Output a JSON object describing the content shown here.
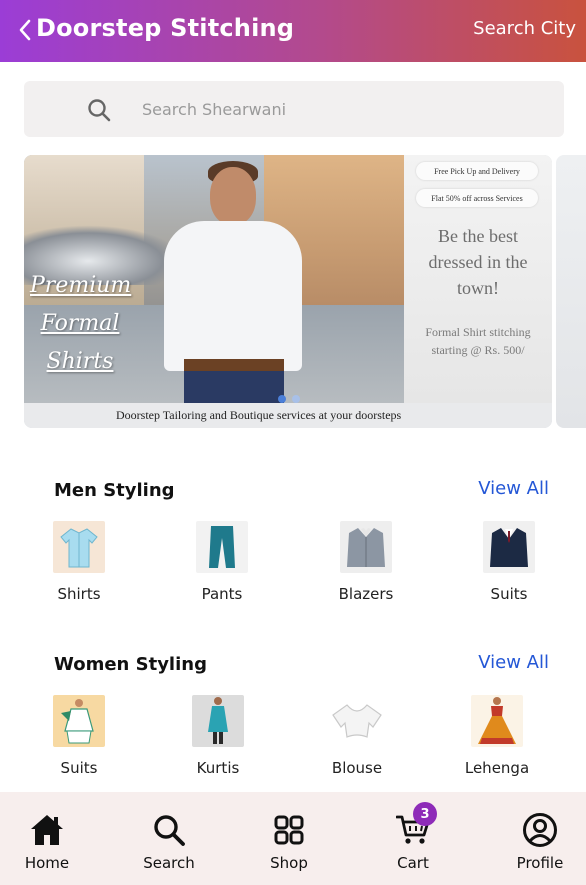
{
  "header": {
    "title": "Doorstep Stitching",
    "city_link": "Search City",
    "back_icon": "chevron-left-icon"
  },
  "search": {
    "placeholder": "Search Shearwani",
    "icon": "search-icon"
  },
  "banner": {
    "premium_lines": [
      "Premium",
      "Formal",
      "Shirts"
    ],
    "pill_1": "Free Pick Up and Delivery",
    "pill_2": "Flat 50% off across Services",
    "tagline": "Be the best dressed in the town!",
    "offer": "Formal Shirt stitching starting @ Rs. 500/",
    "caption": "Doorstep Tailoring and Boutique services at your doorsteps",
    "active_slide": 1,
    "slide_count": 2
  },
  "men": {
    "title": "Men Styling",
    "view_all": "View All",
    "items": [
      {
        "label": "Shirts",
        "icon": "shirt-icon",
        "color": "#a8dcef"
      },
      {
        "label": "Pants",
        "icon": "pants-icon",
        "color": "#1f7a8c"
      },
      {
        "label": "Blazers",
        "icon": "blazer-icon",
        "color": "#8c96a3"
      },
      {
        "label": "Suits",
        "icon": "suit-icon",
        "color": "#1c2a44"
      }
    ]
  },
  "women": {
    "title": "Women Styling",
    "view_all": "View All",
    "items": [
      {
        "label": "Suits",
        "icon": "salwar-suit-icon",
        "color": "#e9b96a"
      },
      {
        "label": "Kurtis",
        "icon": "kurti-icon",
        "color": "#2aa3b3"
      },
      {
        "label": "Blouse",
        "icon": "blouse-icon",
        "color": "#f4f4f4"
      },
      {
        "label": "Lehenga",
        "icon": "lehenga-icon",
        "color": "#e08a1c"
      }
    ]
  },
  "bottom_nav": {
    "items": [
      {
        "label": "Home",
        "icon": "home-icon"
      },
      {
        "label": "Search",
        "icon": "search-icon"
      },
      {
        "label": "Shop",
        "icon": "grid-icon"
      },
      {
        "label": "Cart",
        "icon": "cart-icon",
        "badge": "3"
      },
      {
        "label": "Profile",
        "icon": "profile-icon"
      }
    ]
  },
  "colors": {
    "header_gradient_start": "#9b3dd6",
    "header_gradient_end": "#c9523e",
    "link": "#2457d6",
    "badge": "#8e2bb8",
    "nav_background": "#f7eeed"
  }
}
